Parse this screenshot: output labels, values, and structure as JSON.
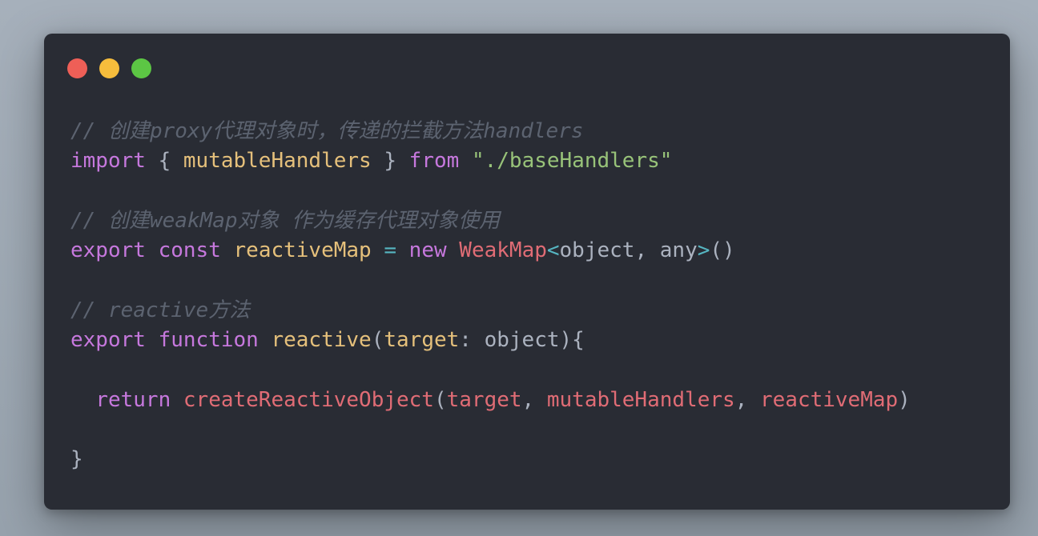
{
  "window": {
    "controls": {
      "close_color": "#ee5f57",
      "minimize_color": "#f6bd3c",
      "maximize_color": "#5cc644"
    }
  },
  "code": {
    "language": "typescript",
    "lines": [
      [
        {
          "t": "// 创建proxy代理对象时，传递的拦截方法handlers",
          "c": "comment"
        }
      ],
      [
        {
          "t": "import",
          "c": "keyword"
        },
        {
          "t": " { ",
          "c": "punc"
        },
        {
          "t": "mutableHandlers",
          "c": "var"
        },
        {
          "t": " } ",
          "c": "punc"
        },
        {
          "t": "from",
          "c": "keyword"
        },
        {
          "t": " ",
          "c": "punc"
        },
        {
          "t": "\"./baseHandlers\"",
          "c": "string"
        }
      ],
      [],
      [
        {
          "t": "// 创建weakMap对象 作为缓存代理对象使用",
          "c": "comment"
        }
      ],
      [
        {
          "t": "export",
          "c": "keyword"
        },
        {
          "t": " ",
          "c": "punc"
        },
        {
          "t": "const",
          "c": "keyword"
        },
        {
          "t": " ",
          "c": "punc"
        },
        {
          "t": "reactiveMap",
          "c": "var"
        },
        {
          "t": " ",
          "c": "punc"
        },
        {
          "t": "=",
          "c": "op"
        },
        {
          "t": " ",
          "c": "punc"
        },
        {
          "t": "new",
          "c": "keyword"
        },
        {
          "t": " ",
          "c": "punc"
        },
        {
          "t": "WeakMap",
          "c": "red"
        },
        {
          "t": "<",
          "c": "op"
        },
        {
          "t": "object, any",
          "c": "type"
        },
        {
          "t": ">",
          "c": "op"
        },
        {
          "t": "()",
          "c": "punc"
        }
      ],
      [],
      [
        {
          "t": "// reactive方法",
          "c": "comment"
        }
      ],
      [
        {
          "t": "export",
          "c": "keyword"
        },
        {
          "t": " ",
          "c": "punc"
        },
        {
          "t": "function",
          "c": "keyword"
        },
        {
          "t": " ",
          "c": "punc"
        },
        {
          "t": "reactive",
          "c": "func"
        },
        {
          "t": "(",
          "c": "punc"
        },
        {
          "t": "target",
          "c": "var"
        },
        {
          "t": ": object){",
          "c": "punc"
        }
      ],
      [],
      [
        {
          "t": "  ",
          "c": "punc"
        },
        {
          "t": "return",
          "c": "keyword"
        },
        {
          "t": " ",
          "c": "punc"
        },
        {
          "t": "createReactiveObject",
          "c": "red"
        },
        {
          "t": "(",
          "c": "punc"
        },
        {
          "t": "target",
          "c": "red"
        },
        {
          "t": ", ",
          "c": "punc"
        },
        {
          "t": "mutableHandlers",
          "c": "red"
        },
        {
          "t": ", ",
          "c": "punc"
        },
        {
          "t": "reactiveMap",
          "c": "red"
        },
        {
          "t": ")",
          "c": "punc"
        }
      ],
      [],
      [
        {
          "t": "}",
          "c": "punc"
        }
      ]
    ]
  }
}
